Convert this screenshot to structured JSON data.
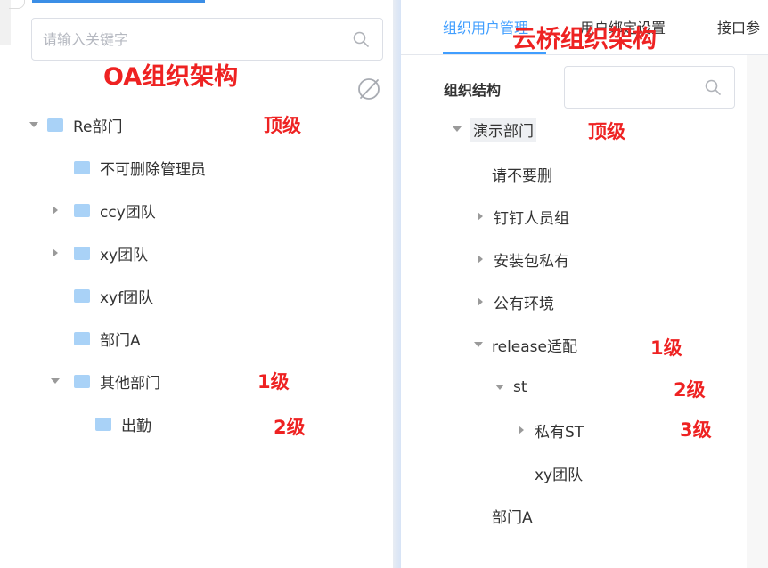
{
  "left": {
    "search_placeholder": "请输入关键字",
    "heading": "OA组织架构",
    "tree": [
      {
        "label": "Re部门",
        "caret": "down",
        "annotation": "顶级"
      },
      {
        "label": "不可删除管理员",
        "caret": "none"
      },
      {
        "label": "ccy团队",
        "caret": "right"
      },
      {
        "label": "xy团队",
        "caret": "right"
      },
      {
        "label": "xyf团队",
        "caret": "none"
      },
      {
        "label": "部门A",
        "caret": "none"
      },
      {
        "label": "其他部门",
        "caret": "down",
        "annotation": "1级"
      },
      {
        "label": "出勤",
        "caret": "none",
        "annotation": "2级"
      }
    ]
  },
  "right": {
    "tabs": [
      {
        "label": "组织用户管理",
        "active": true
      },
      {
        "label": "用户绑定设置",
        "active": false
      },
      {
        "label": "接口参",
        "active": false
      }
    ],
    "heading": "云桥组织架构",
    "org_label": "组织结构",
    "search_placeholder": "",
    "tree": [
      {
        "label": "演示部门",
        "caret": "down",
        "annotation": "顶级"
      },
      {
        "label": "请不要删",
        "caret": "none"
      },
      {
        "label": "钉钉人员组",
        "caret": "right"
      },
      {
        "label": "安装包私有",
        "caret": "right"
      },
      {
        "label": "公有环境",
        "caret": "right"
      },
      {
        "label": "release适配",
        "caret": "down",
        "annotation": "1级"
      },
      {
        "label": "st",
        "caret": "down",
        "annotation": "2级"
      },
      {
        "label": "私有ST",
        "caret": "right",
        "annotation": "3级"
      },
      {
        "label": "xy团队",
        "caret": "none"
      },
      {
        "label": "部门A",
        "caret": "none"
      }
    ]
  },
  "colors": {
    "accent": "#409eff",
    "annotation": "#ee2222",
    "folder": "#a9d2f7"
  },
  "icons": [
    "search-icon",
    "eye-off-icon",
    "folder-icon",
    "caret-right-icon",
    "caret-down-icon"
  ]
}
